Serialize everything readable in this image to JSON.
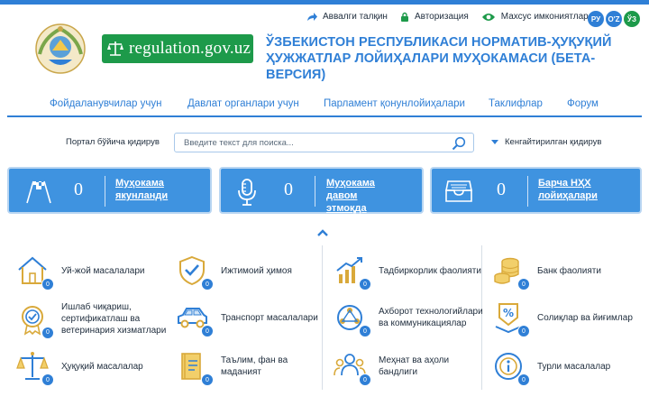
{
  "top_links": [
    {
      "label": "Аввалги талқин",
      "icon": "share-arrow-icon"
    },
    {
      "label": "Авторизация",
      "icon": "lock-icon"
    },
    {
      "label": "Махсус имкониятлар",
      "icon": "eye-icon"
    }
  ],
  "languages": [
    {
      "code": "РУ",
      "active": false
    },
    {
      "code": "O'Z",
      "active": false
    },
    {
      "code": "ЎЗ",
      "active": true
    }
  ],
  "logo": {
    "text": "regulation.gov.uz"
  },
  "site_title": {
    "line1": "ЎЗБЕКИСТОН РЕСПУБЛИКАСИ НОРМАТИВ-ҲУҚУҚИЙ",
    "line2": "ҲУЖЖАТЛАР ЛОЙИҲАЛАРИ МУҲОКАМАСИ (БЕТА-ВЕРСИЯ)"
  },
  "nav": [
    "Фойдаланувчилар учун",
    "Давлат органлари учун",
    "Парламент қонунлойиҳалари",
    "Таклифлар",
    "Форум"
  ],
  "search": {
    "label": "Портал бўйича қидирув",
    "placeholder": "Введите текст для поиска...",
    "advanced": "Кенгайтирилган қидирув"
  },
  "cards": [
    {
      "count": "0",
      "line1": "Муҳокама",
      "line2": "якунланди",
      "line3": "",
      "icon": "finish-flags-icon"
    },
    {
      "count": "0",
      "line1": "Муҳокама",
      "line2": "давом",
      "line3": "этмоқда",
      "icon": "microphone-icon"
    },
    {
      "count": "0",
      "line1": "Барча НҲХ",
      "line2": "лойиҳалари",
      "line3": "",
      "icon": "archive-box-icon"
    }
  ],
  "categories": [
    {
      "label": "Уй-жой масалалари",
      "count": "0",
      "icon": "house-icon"
    },
    {
      "label": "Ижтимоий ҳимоя",
      "count": "0",
      "icon": "shield-check-icon"
    },
    {
      "label": "Тадбиркорлик фаолияти",
      "count": "0",
      "icon": "growth-chart-icon"
    },
    {
      "label": "Банк фаолияти",
      "count": "0",
      "icon": "coins-icon"
    },
    {
      "label": "Ишлаб чиқариш, сертификатлаш ва ветеринария хизматлари",
      "count": "0",
      "icon": "certificate-icon"
    },
    {
      "label": "Транспорт масалалари",
      "count": "0",
      "icon": "car-icon"
    },
    {
      "label": "Ахборот технологийлари ва коммуникациялар",
      "count": "0",
      "icon": "network-globe-icon"
    },
    {
      "label": "Солиқлар ва йиғимлар",
      "count": "0",
      "icon": "percent-tax-icon"
    },
    {
      "label": "Ҳуқуқий масалалар",
      "count": "0",
      "icon": "justice-scale-icon"
    },
    {
      "label": "Таълим, фан ва маданият",
      "count": "0",
      "icon": "book-icon"
    },
    {
      "label": "Меҳнат ва аҳоли бандлиги",
      "count": "0",
      "icon": "team-icon"
    },
    {
      "label": "Турли масалалар",
      "count": "0",
      "icon": "info-circle-icon"
    }
  ],
  "colors": {
    "accent": "#2f7fd6",
    "brand_green": "#1d9a4a",
    "card": "#3f93e0",
    "icon_gold": "#d9a93a"
  }
}
